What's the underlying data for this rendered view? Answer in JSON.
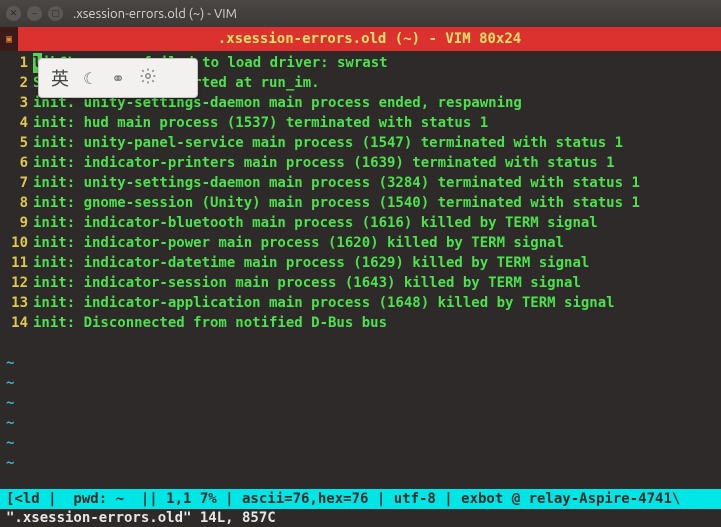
{
  "window": {
    "title": ".xsession-errors.old (~) - VIM"
  },
  "tabbar": {
    "title": ".xsession-errors.old (~) - VIM 80x24"
  },
  "lines": [
    {
      "num": "1",
      "pre": "",
      "cur": "l",
      "post": "ibGL error: failed to load driver: swrast"
    },
    {
      "num": "2",
      "pre": "S",
      "cur": "",
      "post": "                tarted at run_im."
    },
    {
      "num": "3",
      "pre": "i",
      "cur": "",
      "post": "nit. unity-settings-daemon main process ended, respawning"
    },
    {
      "num": "4",
      "pre": "init: hud main process (1537) terminated with status 1",
      "cur": "",
      "post": ""
    },
    {
      "num": "5",
      "pre": "init: unity-panel-service main process (1547) terminated with status 1",
      "cur": "",
      "post": ""
    },
    {
      "num": "6",
      "pre": "init: indicator-printers main process (1639) terminated with status 1",
      "cur": "",
      "post": ""
    },
    {
      "num": "7",
      "pre": "init: unity-settings-daemon main process (3284) terminated with status 1",
      "cur": "",
      "post": ""
    },
    {
      "num": "8",
      "pre": "init: gnome-session (Unity) main process (1540) terminated with status 1",
      "cur": "",
      "post": ""
    },
    {
      "num": "9",
      "pre": "init: indicator-bluetooth main process (1616) killed by TERM signal",
      "cur": "",
      "post": ""
    },
    {
      "num": "10",
      "pre": "init: indicator-power main process (1620) killed by TERM signal",
      "cur": "",
      "post": ""
    },
    {
      "num": "11",
      "pre": "init: indicator-datetime main process (1629) killed by TERM signal",
      "cur": "",
      "post": ""
    },
    {
      "num": "12",
      "pre": "init: indicator-session main process (1643) killed by TERM signal",
      "cur": "",
      "post": ""
    },
    {
      "num": "13",
      "pre": "init: indicator-application main process (1648) killed by TERM signal",
      "cur": "",
      "post": ""
    },
    {
      "num": "14",
      "pre": "init: Disconnected from notified D-Bus bus",
      "cur": "",
      "post": ""
    }
  ],
  "tilde_rows": 6,
  "tilde_char": "~",
  "status": "[<ld |  pwd: ~  || 1,1 7% | ascii=76,hex=76 | utf-8 | exbot @ relay-Aspire-4741\\",
  "cmdline": "\".xsession-errors.old\" 14L, 857C",
  "ime": {
    "lang": "英",
    "moon": "☾",
    "link": "⚭",
    "gear": "gear"
  }
}
